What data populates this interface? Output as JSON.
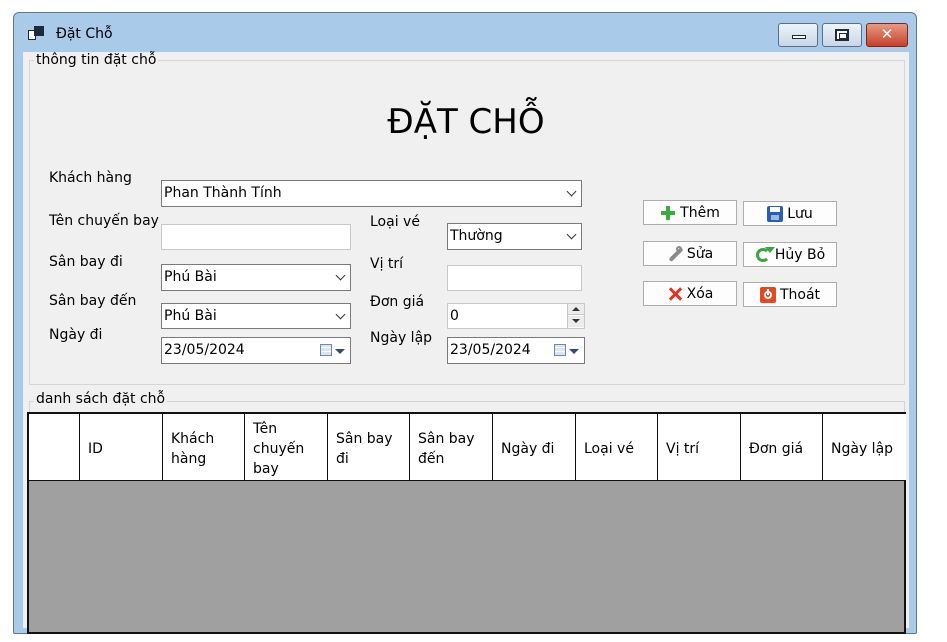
{
  "window": {
    "title": "Đặt Chỗ"
  },
  "groups": {
    "info_label": "thông tin đặt chỗ",
    "list_label": "danh sách đặt chỗ"
  },
  "heading": "ĐẶT CHỖ",
  "form": {
    "khach_hang_label": "Khách hàng",
    "khach_hang_value": "Phan Thành Tính",
    "ten_chuyen_bay_label": "Tên chuyến bay",
    "ten_chuyen_bay_value": "",
    "san_bay_di_label": "Sân bay đi",
    "san_bay_di_value": "Phú Bài",
    "san_bay_den_label": "Sân bay đến",
    "san_bay_den_value": "Phú Bài",
    "ngay_di_label": "Ngày đi",
    "ngay_di_value": "23/05/2024",
    "loai_ve_label": "Loại vé",
    "loai_ve_value": "Thường",
    "vi_tri_label": "Vị trí",
    "vi_tri_value": "",
    "don_gia_label": "Đơn giá",
    "don_gia_value": "0",
    "ngay_lap_label": "Ngày lập",
    "ngay_lap_value": "23/05/2024"
  },
  "buttons": {
    "them": "Thêm",
    "luu": "Lưu",
    "sua": "Sửa",
    "huy_bo": "Hủy Bỏ",
    "xoa": "Xóa",
    "thoat": "Thoát"
  },
  "table": {
    "columns": [
      "",
      "ID",
      "Khách hàng",
      "Tên chuyến bay",
      "Sân bay đi",
      "Sân bay đến",
      "Ngày đi",
      "Loại vé",
      "Vị trí",
      "Đơn giá",
      "Ngày lập"
    ]
  },
  "icons": [
    "app-icon",
    "minimize-icon",
    "maximize-icon",
    "close-icon",
    "plus-icon",
    "save-icon",
    "wrench-icon",
    "refresh-icon",
    "delete-icon",
    "exit-icon",
    "calendar-icon",
    "chevron-down-icon"
  ]
}
